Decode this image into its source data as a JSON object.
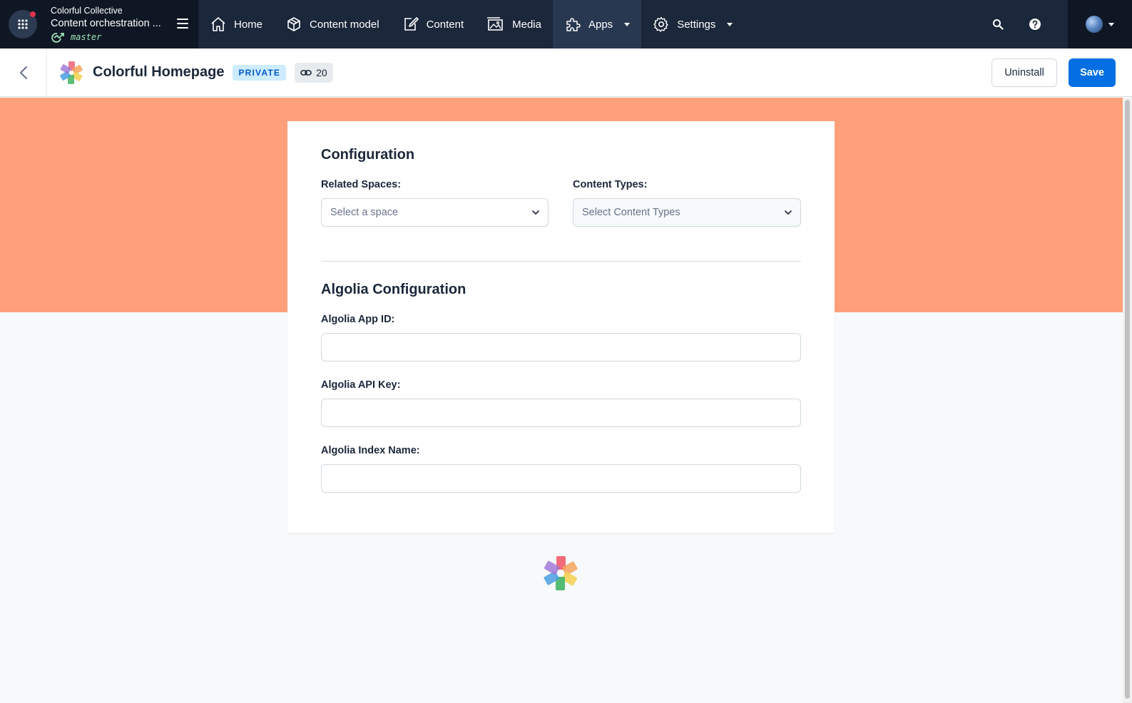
{
  "topnav": {
    "org_name": "Colorful Collective",
    "space_name": "Content orchestration ...",
    "environment": "master",
    "items": [
      {
        "label": "Home",
        "icon": "home-icon"
      },
      {
        "label": "Content model",
        "icon": "cube-icon"
      },
      {
        "label": "Content",
        "icon": "edit-icon"
      },
      {
        "label": "Media",
        "icon": "image-icon"
      },
      {
        "label": "Apps",
        "icon": "puzzle-icon"
      },
      {
        "label": "Settings",
        "icon": "gear-icon"
      }
    ],
    "active_item": "Apps"
  },
  "app_header": {
    "title": "Colorful Homepage",
    "visibility_badge": "PRIVATE",
    "references_count": "20",
    "uninstall_label": "Uninstall",
    "save_label": "Save"
  },
  "config": {
    "heading": "Configuration",
    "related_spaces_label": "Related Spaces:",
    "related_spaces_placeholder": "Select a space",
    "content_types_label": "Content Types:",
    "content_types_placeholder": "Select Content Types"
  },
  "algolia": {
    "heading": "Algolia Configuration",
    "app_id_label": "Algolia App ID:",
    "app_id_value": "",
    "api_key_label": "Algolia API Key:",
    "api_key_value": "",
    "index_name_label": "Algolia Index Name:",
    "index_name_value": ""
  },
  "colors": {
    "nav_background": "#1b273a",
    "hero_band": "#ffa07a",
    "primary": "#036fe3",
    "badge_background": "#ceecff",
    "badge_text": "#0059c8"
  }
}
